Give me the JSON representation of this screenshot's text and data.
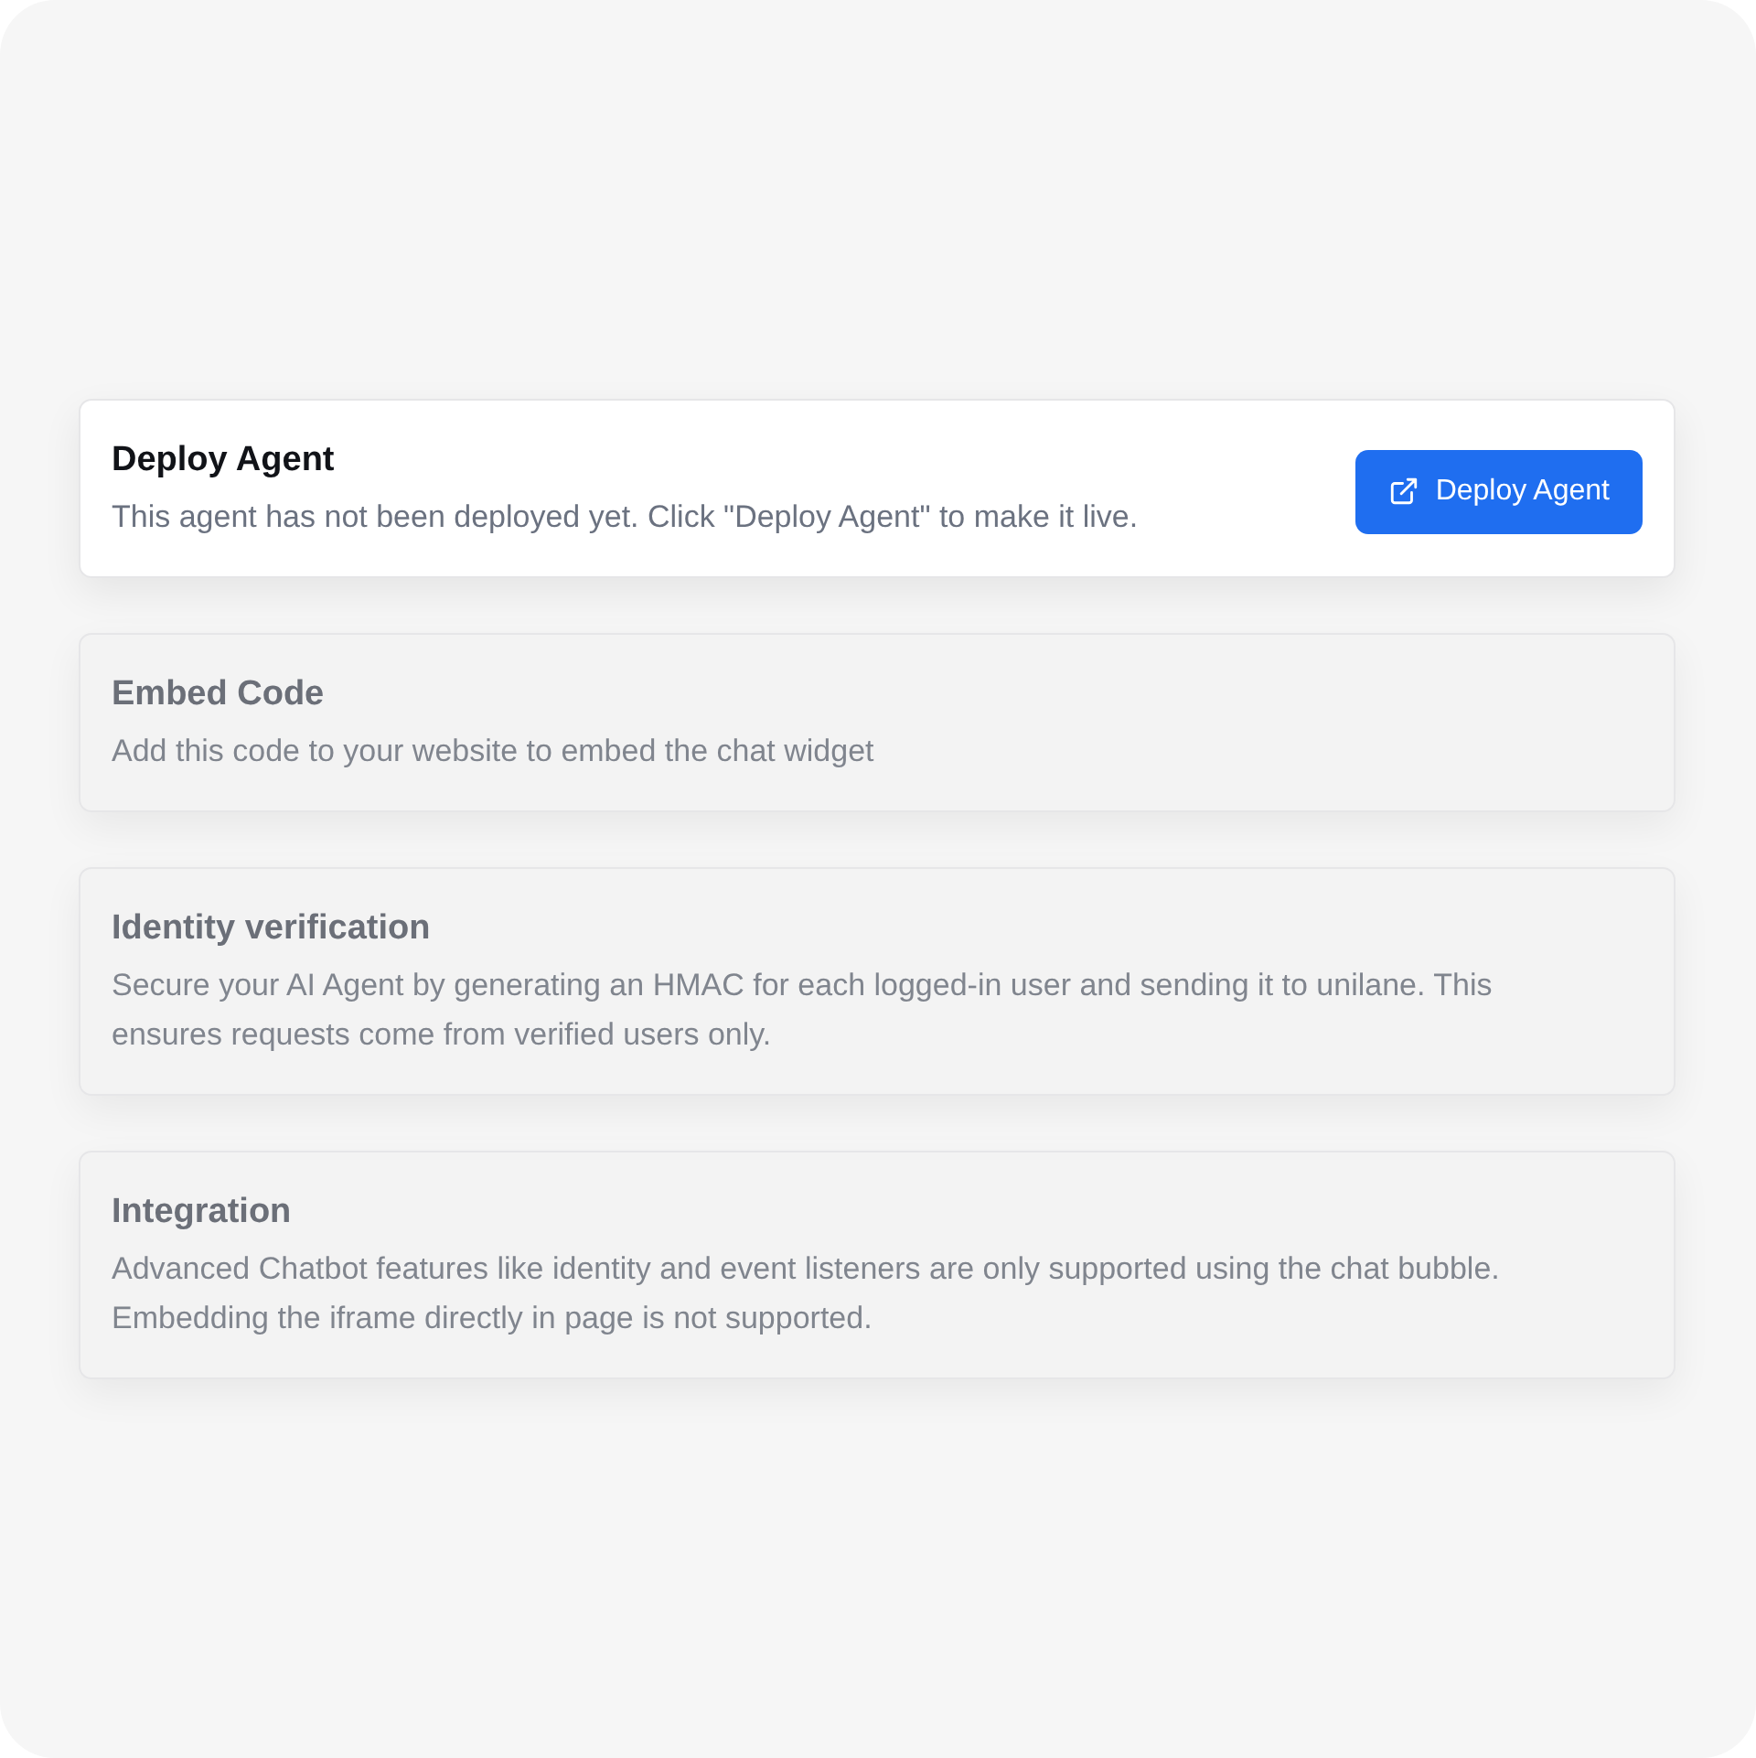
{
  "sections": [
    {
      "title": "Deploy Agent",
      "description": "This agent has not been deployed yet. Click \"Deploy Agent\" to make it live.",
      "disabled": false,
      "button": {
        "label": "Deploy Agent"
      }
    },
    {
      "title": "Embed Code",
      "description": "Add this code to your website to embed the chat widget",
      "disabled": true
    },
    {
      "title": "Identity verification",
      "description": "Secure your AI Agent by generating an HMAC for each logged-in user and sending it to unilane. This ensures requests come from verified users only.",
      "disabled": true
    },
    {
      "title": "Integration",
      "description": "Advanced Chatbot features like identity and event listeners are only supported using the chat bubble. Embedding the iframe directly in page is not supported.",
      "disabled": true
    }
  ]
}
